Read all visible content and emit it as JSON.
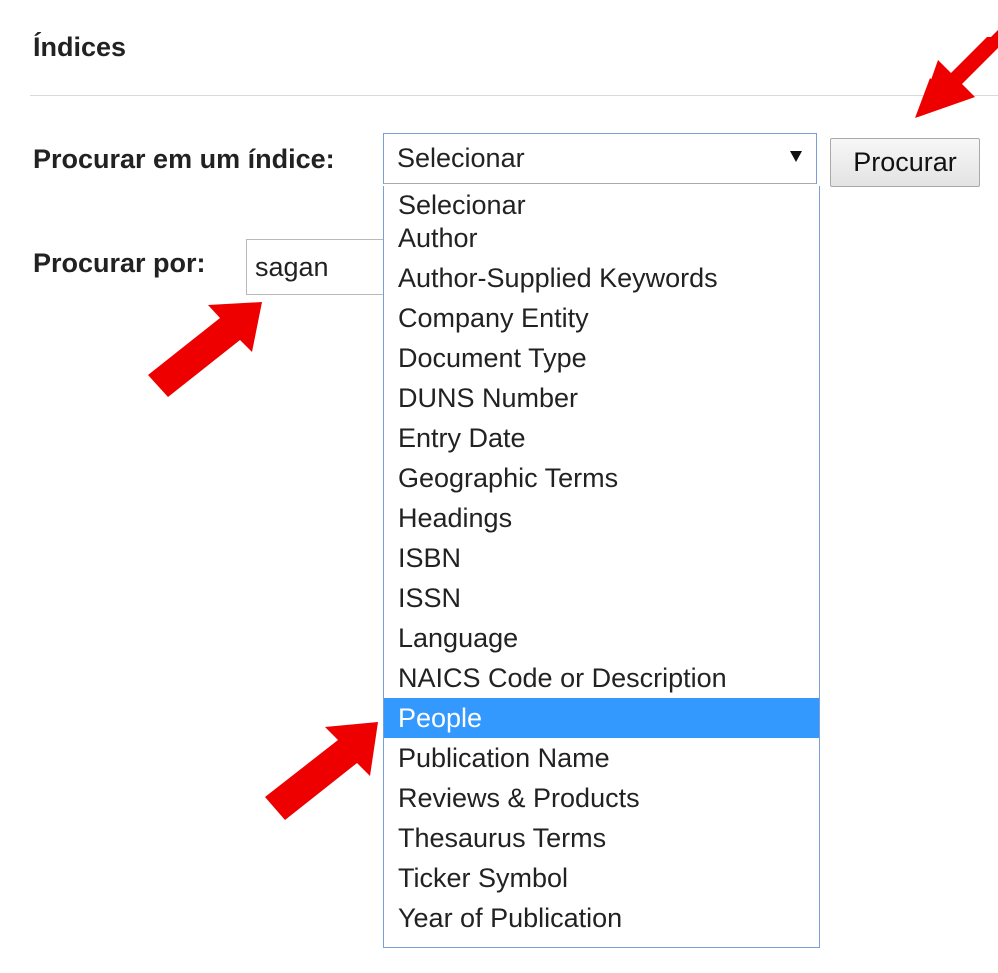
{
  "section": {
    "title": "Índices"
  },
  "form": {
    "index_label": "Procurar em um índice:",
    "term_label": "Procurar por:",
    "select_value": "Selecionar",
    "submit_label": "Procurar",
    "term_value": "sagan"
  },
  "dropdown": {
    "options": [
      {
        "label": "Selecionar"
      },
      {
        "label": "Author"
      },
      {
        "label": "Author-Supplied Keywords"
      },
      {
        "label": "Company Entity"
      },
      {
        "label": "Document Type"
      },
      {
        "label": "DUNS Number"
      },
      {
        "label": "Entry Date"
      },
      {
        "label": "Geographic Terms"
      },
      {
        "label": "Headings"
      },
      {
        "label": "ISBN"
      },
      {
        "label": "ISSN"
      },
      {
        "label": "Language"
      },
      {
        "label": "NAICS Code or Description"
      },
      {
        "label": "People"
      },
      {
        "label": "Publication Name"
      },
      {
        "label": "Reviews & Products"
      },
      {
        "label": "Thesaurus Terms"
      },
      {
        "label": "Ticker Symbol"
      },
      {
        "label": "Year of Publication"
      }
    ],
    "highlighted": "People"
  },
  "colors": {
    "highlight": "#3399ff",
    "annotation_arrow": "#ee0000"
  }
}
